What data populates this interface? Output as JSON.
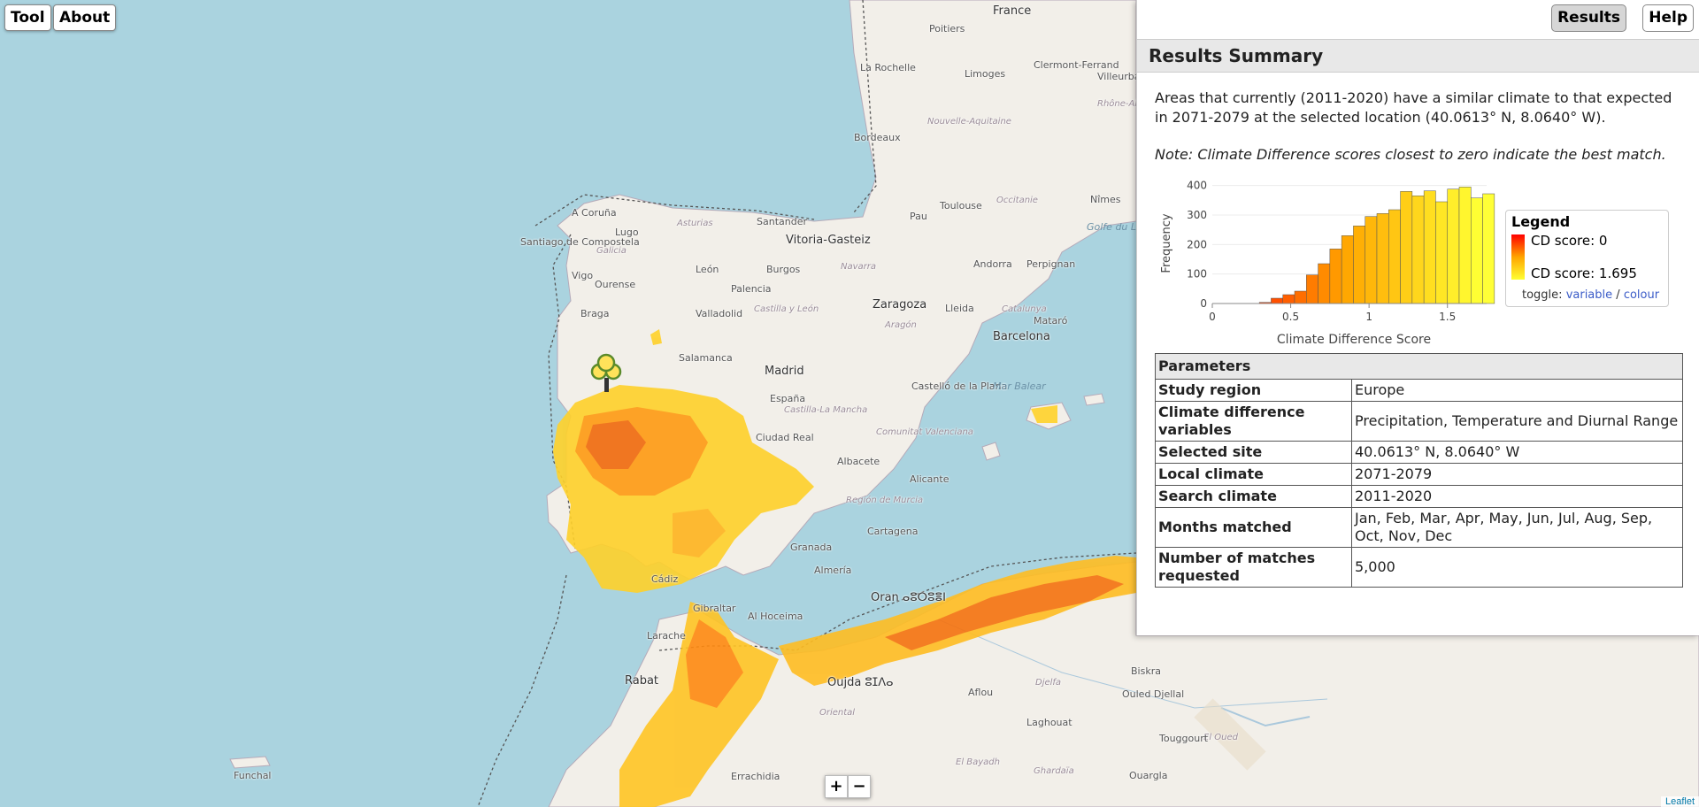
{
  "top": {
    "tool_label": "Tool",
    "about_label": "About"
  },
  "panel": {
    "results_label": "Results",
    "help_label": "Help",
    "summary_title": "Results Summary",
    "description": "Areas that currently (2011-2020) have a similar climate to that expected in 2071-2079 at the selected location (40.0613° N, 8.0640° W).",
    "note": "Note: Climate Difference scores closest to zero indicate the best match."
  },
  "legend": {
    "title": "Legend",
    "min_label": "CD score: 0",
    "max_label": "CD score: 1.695",
    "toggle_prefix": "toggle:",
    "toggle_variable": "variable",
    "toggle_sep": "/",
    "toggle_colour": "colour",
    "colors": [
      "#ff0000",
      "#ffa500",
      "#ffff33"
    ]
  },
  "chart_data": {
    "type": "bar",
    "xlabel": "Climate Difference Score",
    "ylabel": "Frequency",
    "xlim": [
      0,
      1.75
    ],
    "ylim": [
      0,
      420
    ],
    "xticks": [
      0,
      0.5,
      1,
      1.5
    ],
    "xtick_labels": [
      "0",
      "0.5",
      "1",
      "1.5"
    ],
    "yticks": [
      0,
      100,
      200,
      300,
      400
    ],
    "bin_width": 0.075,
    "bin_start": 0.3,
    "values": [
      4,
      18,
      30,
      42,
      97,
      135,
      185,
      230,
      263,
      295,
      305,
      318,
      380,
      365,
      382,
      345,
      388,
      395,
      358,
      372
    ]
  },
  "params": {
    "header": "Parameters",
    "rows": [
      {
        "key": "Study region",
        "value": "Europe"
      },
      {
        "key": "Climate difference variables",
        "value": "Precipitation, Temperature and Diurnal Range"
      },
      {
        "key": "Selected site",
        "value": "40.0613° N, 8.0640° W"
      },
      {
        "key": "Local climate",
        "value": "2071-2079"
      },
      {
        "key": "Search climate",
        "value": "2011-2020"
      },
      {
        "key": "Months matched",
        "value": "Jan, Feb, Mar, Apr, May, Jun, Jul, Aug, Sep, Oct, Nov, Dec"
      },
      {
        "key": "Number of matches requested",
        "value": "5,000"
      }
    ]
  },
  "zoom": {
    "in_label": "+",
    "out_label": "−"
  },
  "attribution": "Leaflet",
  "map_labels": {
    "france": "France",
    "poitiers": "Poitiers",
    "larochelle": "La Rochelle",
    "limoges": "Limoges",
    "clermont": "Clermont-Ferrand",
    "villeurbanne": "Villeurbanne",
    "rhone": "Rhône-Alpes",
    "nouvelle": "Nouvelle-Aquitaine",
    "bordeaux": "Bordeaux",
    "toulouse": "Toulouse",
    "occitanie": "Occitanie",
    "nimes": "Nîmes",
    "golfe": "Golfe du Lion",
    "coruna": "A Coruña",
    "santiago": "Santiago de Compostela",
    "galicia": "Galicia",
    "lugo": "Lugo",
    "asturias": "Asturias",
    "santander": "Santander",
    "vitoria": "Vitoria-Gasteiz",
    "pau": "Pau",
    "andorra": "Andorra",
    "perpignan": "Perpignan",
    "navarra": "Navarra",
    "burgos": "Burgos",
    "leon": "León",
    "vigo": "Vigo",
    "ourense": "Ourense",
    "palencia": "Palencia",
    "zaragoza": "Zaragoza",
    "lleida": "Lleida",
    "catalunya": "Catalunya",
    "aragon": "Aragón",
    "braga": "Braga",
    "valladolid": "Valladolid",
    "castilla": "Castilla y León",
    "mataro": "Mataró",
    "barcelona": "Barcelona",
    "salamanca": "Salamanca",
    "madrid": "Madrid",
    "espana": "España",
    "castellon": "Castelló de la Plana",
    "marbalear": "Mar Balear",
    "castillamancha": "Castilla-La Mancha",
    "ciudadreal": "Ciudad Real",
    "valenciana": "Comunitat Valenciana",
    "albacete": "Albacete",
    "alicante": "Alicante",
    "murcia": "Región de Murcia",
    "cartagena": "Cartagena",
    "granada": "Granada",
    "almeria": "Almería",
    "cadiz": "Cádiz",
    "gibraltar": "Gibraltar",
    "oran": "Oran ⴰⵓⵔⵓⴻⵏ",
    "alhoceima": "Al Hoceima",
    "larache": "Larache",
    "rabat": "Rabat",
    "oujda": "Oujda ⵓⵊⴷⴰ",
    "oriental": "Oriental",
    "aflou": "Aflou",
    "djelfa": "Djelfa",
    "biskra": "Biskra",
    "eloued": "El Oued",
    "ouled": "Ouled Djellal",
    "laghouat": "Laghouat",
    "touggourt": "Touggourt",
    "ghardaia": "Ghardaïa",
    "ouargla": "Ouargla",
    "elbayadh": "El Bayadh",
    "errachidia": "Errachidia",
    "funchal": "Funchal"
  }
}
